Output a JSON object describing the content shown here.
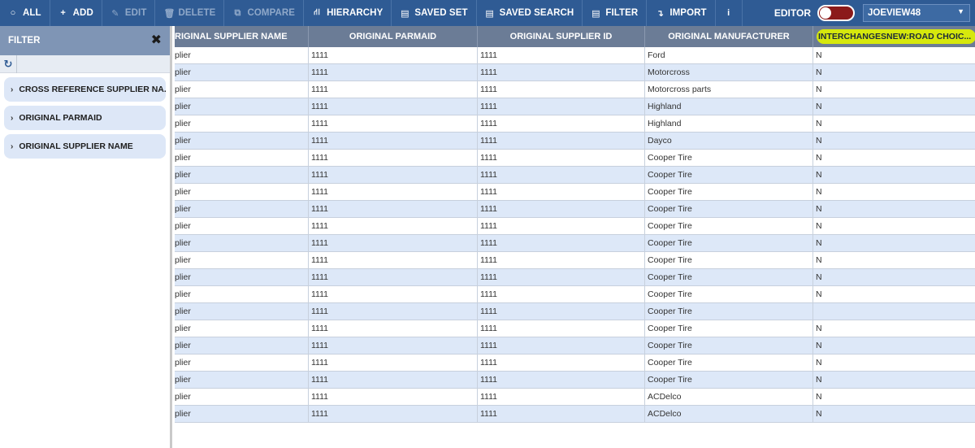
{
  "toolbar": {
    "buttons": [
      {
        "label": "ALL",
        "icon": "circle-icon",
        "glyph": "○",
        "disabled": false
      },
      {
        "label": "ADD",
        "icon": "plus-icon",
        "glyph": "+",
        "disabled": false
      },
      {
        "label": "EDIT",
        "icon": "pencil-icon",
        "glyph": "✎",
        "disabled": true
      },
      {
        "label": "DELETE",
        "icon": "trash-icon",
        "glyph": "🗑",
        "disabled": true
      },
      {
        "label": "COMPARE",
        "icon": "compare-icon",
        "glyph": "⧉",
        "disabled": true
      },
      {
        "label": "HIERARCHY",
        "icon": "hierarchy-icon",
        "glyph": "⛙",
        "disabled": false
      },
      {
        "label": "SAVED SET",
        "icon": "saved-set-icon",
        "glyph": "▤",
        "disabled": false
      },
      {
        "label": "SAVED SEARCH",
        "icon": "saved-search-icon",
        "glyph": "▤",
        "disabled": false
      },
      {
        "label": "FILTER",
        "icon": "filter-icon",
        "glyph": "▤",
        "disabled": false
      },
      {
        "label": "IMPORT",
        "icon": "import-icon",
        "glyph": "↴",
        "disabled": false
      },
      {
        "label": "",
        "icon": "info-icon",
        "glyph": "i",
        "disabled": false
      }
    ],
    "editor_label": "EDITOR",
    "editor_on": false,
    "user": "JOEVIEW48",
    "colors": {
      "bar": "#2f5b94",
      "toggle_off": "#8b1a1a"
    }
  },
  "filter": {
    "title": "FILTER",
    "close_glyph": "✖",
    "refresh_glyph": "↻",
    "items": [
      {
        "label": "CROSS REFERENCE SUPPLIER NA..."
      },
      {
        "label": "ORIGINAL PARMAID"
      },
      {
        "label": "ORIGINAL SUPPLIER NAME"
      }
    ]
  },
  "grid": {
    "columns": [
      "RIGINAL SUPPLIER NAME",
      "ORIGINAL PARMAID",
      "ORIGINAL SUPPLIER ID",
      "ORIGINAL MANUFACTURER",
      "INTERCHANGESNEW:ROAD CHOIC..."
    ],
    "highlight_color": "#d6e80d",
    "rows": [
      [
        "plier",
        "1111",
        "1111",
        "Ford",
        "N"
      ],
      [
        "plier",
        "1111",
        "1111",
        "Motorcross",
        "N"
      ],
      [
        "plier",
        "1111",
        "1111",
        "Motorcross parts",
        "N"
      ],
      [
        "plier",
        "1111",
        "1111",
        "Highland",
        "N"
      ],
      [
        "plier",
        "1111",
        "1111",
        "Highland",
        "N"
      ],
      [
        "plier",
        "1111",
        "1111",
        "Dayco",
        "N"
      ],
      [
        "plier",
        "1111",
        "1111",
        "Cooper Tire",
        "N"
      ],
      [
        "plier",
        "1111",
        "1111",
        "Cooper Tire",
        "N"
      ],
      [
        "plier",
        "1111",
        "1111",
        "Cooper Tire",
        "N"
      ],
      [
        "plier",
        "1111",
        "1111",
        "Cooper Tire",
        "N"
      ],
      [
        "plier",
        "1111",
        "1111",
        "Cooper Tire",
        "N"
      ],
      [
        "plier",
        "1111",
        "1111",
        "Cooper Tire",
        "N"
      ],
      [
        "plier",
        "1111",
        "1111",
        "Cooper Tire",
        "N"
      ],
      [
        "plier",
        "1111",
        "1111",
        "Cooper Tire",
        "N"
      ],
      [
        "plier",
        "1111",
        "1111",
        "Cooper Tire",
        "N"
      ],
      [
        "plier",
        "1111",
        "1111",
        "Cooper Tire",
        ""
      ],
      [
        "plier",
        "1111",
        "1111",
        "Cooper Tire",
        "N"
      ],
      [
        "plier",
        "1111",
        "1111",
        "Cooper Tire",
        "N"
      ],
      [
        "plier",
        "1111",
        "1111",
        "Cooper Tire",
        "N"
      ],
      [
        "plier",
        "1111",
        "1111",
        "Cooper Tire",
        "N"
      ],
      [
        "plier",
        "1111",
        "1111",
        "ACDelco",
        "N"
      ],
      [
        "plier",
        "1111",
        "1111",
        "ACDelco",
        "N"
      ]
    ]
  }
}
